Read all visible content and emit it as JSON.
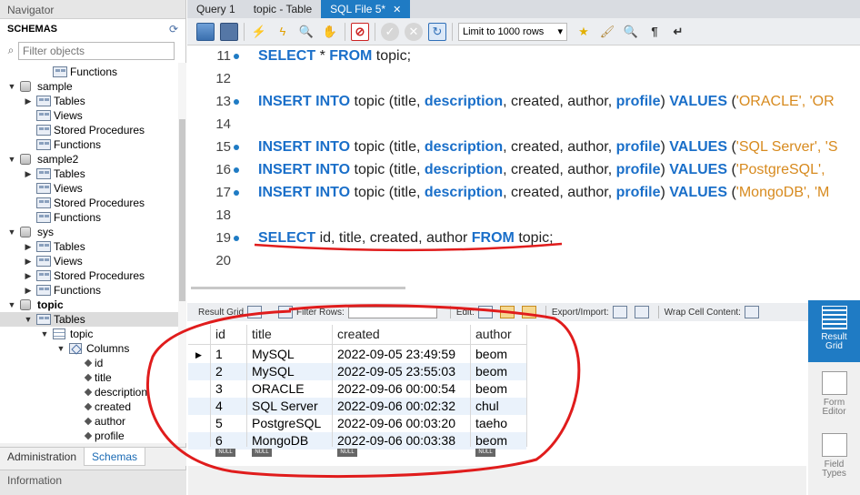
{
  "navigator": {
    "title": "Navigator",
    "schemas_label": "SCHEMAS",
    "filter_placeholder": "Filter objects",
    "tree": [
      {
        "indent": 0,
        "twisty": "",
        "icon": "folder",
        "label": "Functions",
        "depth": 2
      },
      {
        "indent": 0,
        "twisty": "▼",
        "icon": "db",
        "label": "sample",
        "depth": 0
      },
      {
        "indent": 1,
        "twisty": "▶",
        "icon": "folder",
        "label": "Tables",
        "depth": 1
      },
      {
        "indent": 1,
        "twisty": "",
        "icon": "folder",
        "label": "Views",
        "depth": 1
      },
      {
        "indent": 1,
        "twisty": "",
        "icon": "folder",
        "label": "Stored Procedures",
        "depth": 1
      },
      {
        "indent": 1,
        "twisty": "",
        "icon": "folder",
        "label": "Functions",
        "depth": 1
      },
      {
        "indent": 0,
        "twisty": "▼",
        "icon": "db",
        "label": "sample2",
        "depth": 0
      },
      {
        "indent": 1,
        "twisty": "▶",
        "icon": "folder",
        "label": "Tables",
        "depth": 1
      },
      {
        "indent": 1,
        "twisty": "",
        "icon": "folder",
        "label": "Views",
        "depth": 1
      },
      {
        "indent": 1,
        "twisty": "",
        "icon": "folder",
        "label": "Stored Procedures",
        "depth": 1
      },
      {
        "indent": 1,
        "twisty": "",
        "icon": "folder",
        "label": "Functions",
        "depth": 1
      },
      {
        "indent": 0,
        "twisty": "▼",
        "icon": "db",
        "label": "sys",
        "depth": 0
      },
      {
        "indent": 1,
        "twisty": "▶",
        "icon": "folder",
        "label": "Tables",
        "depth": 1
      },
      {
        "indent": 1,
        "twisty": "▶",
        "icon": "folder",
        "label": "Views",
        "depth": 1
      },
      {
        "indent": 1,
        "twisty": "▶",
        "icon": "folder",
        "label": "Stored Procedures",
        "depth": 1
      },
      {
        "indent": 1,
        "twisty": "▶",
        "icon": "folder",
        "label": "Functions",
        "depth": 1
      },
      {
        "indent": 0,
        "twisty": "▼",
        "icon": "db",
        "label": "topic",
        "depth": 0,
        "bold": true
      },
      {
        "indent": 1,
        "twisty": "▼",
        "icon": "folder",
        "label": "Tables",
        "depth": 1,
        "selected": true
      },
      {
        "indent": 2,
        "twisty": "▼",
        "icon": "table",
        "label": "topic",
        "depth": 2
      },
      {
        "indent": 3,
        "twisty": "▼",
        "icon": "col",
        "label": "Columns",
        "depth": 3
      },
      {
        "indent": 4,
        "twisty": "",
        "icon": "dot",
        "label": "id",
        "depth": 4
      },
      {
        "indent": 4,
        "twisty": "",
        "icon": "dot",
        "label": "title",
        "depth": 4
      },
      {
        "indent": 4,
        "twisty": "",
        "icon": "dot",
        "label": "description",
        "depth": 4
      },
      {
        "indent": 4,
        "twisty": "",
        "icon": "dot",
        "label": "created",
        "depth": 4
      },
      {
        "indent": 4,
        "twisty": "",
        "icon": "dot",
        "label": "author",
        "depth": 4
      },
      {
        "indent": 4,
        "twisty": "",
        "icon": "dot",
        "label": "profile",
        "depth": 4
      }
    ],
    "tabs": [
      {
        "label": "Administration",
        "active": false
      },
      {
        "label": "Schemas",
        "active": true
      }
    ],
    "info_label": "Information"
  },
  "tabs": [
    {
      "label": "Query 1",
      "active": false
    },
    {
      "label": "topic - Table",
      "active": false
    },
    {
      "label": "SQL File 5*",
      "active": true,
      "close": "✕"
    }
  ],
  "toolbar": {
    "limit_label": "Limit to 1000 rows"
  },
  "editor": {
    "lines": [
      {
        "num": "11",
        "bp": true,
        "tokens": [
          [
            "kw",
            "SELECT"
          ],
          [
            "pl",
            " * "
          ],
          [
            "kw",
            "FROM"
          ],
          [
            "pl",
            " topic;"
          ]
        ]
      },
      {
        "num": "12",
        "bp": false,
        "tokens": []
      },
      {
        "num": "13",
        "bp": true,
        "tokens": [
          [
            "kw",
            "INSERT INTO"
          ],
          [
            "pl",
            " topic (title, "
          ],
          [
            "kw",
            "description"
          ],
          [
            "pl",
            ", created, author, "
          ],
          [
            "kw",
            "profile"
          ],
          [
            "pl",
            ") "
          ],
          [
            "kw",
            "VALUES"
          ],
          [
            "pl",
            " ("
          ],
          [
            "str",
            "'ORACLE', 'OR"
          ]
        ]
      },
      {
        "num": "14",
        "bp": false,
        "tokens": []
      },
      {
        "num": "15",
        "bp": true,
        "tokens": [
          [
            "kw",
            "INSERT INTO"
          ],
          [
            "pl",
            " topic (title, "
          ],
          [
            "kw",
            "description"
          ],
          [
            "pl",
            ", created, author, "
          ],
          [
            "kw",
            "profile"
          ],
          [
            "pl",
            ") "
          ],
          [
            "kw",
            "VALUES"
          ],
          [
            "pl",
            " ("
          ],
          [
            "str",
            "'SQL Server', 'S"
          ]
        ]
      },
      {
        "num": "16",
        "bp": true,
        "tokens": [
          [
            "kw",
            "INSERT INTO"
          ],
          [
            "pl",
            " topic (title, "
          ],
          [
            "kw",
            "description"
          ],
          [
            "pl",
            ", created, author, "
          ],
          [
            "kw",
            "profile"
          ],
          [
            "pl",
            ") "
          ],
          [
            "kw",
            "VALUES"
          ],
          [
            "pl",
            " ("
          ],
          [
            "str",
            "'PostgreSQL', "
          ]
        ]
      },
      {
        "num": "17",
        "bp": true,
        "tokens": [
          [
            "kw",
            "INSERT INTO"
          ],
          [
            "pl",
            " topic (title, "
          ],
          [
            "kw",
            "description"
          ],
          [
            "pl",
            ", created, author, "
          ],
          [
            "kw",
            "profile"
          ],
          [
            "pl",
            ") "
          ],
          [
            "kw",
            "VALUES"
          ],
          [
            "pl",
            " ("
          ],
          [
            "str",
            "'MongoDB', 'M"
          ]
        ]
      },
      {
        "num": "18",
        "bp": false,
        "tokens": []
      },
      {
        "num": "19",
        "bp": true,
        "tokens": [
          [
            "kw",
            "SELECT"
          ],
          [
            "pl",
            " id, title, created, author "
          ],
          [
            "kw",
            "FROM"
          ],
          [
            "pl",
            " topic;"
          ]
        ]
      },
      {
        "num": "20",
        "bp": false,
        "tokens": []
      }
    ]
  },
  "result_toolbar": {
    "result_grid": "Result Grid",
    "filter_rows": "Filter Rows:",
    "edit": "Edit:",
    "export_import": "Export/Import:",
    "wrap": "Wrap Cell Content:"
  },
  "grid": {
    "columns": [
      "id",
      "title",
      "created",
      "author"
    ],
    "rows": [
      [
        "1",
        "MySQL",
        "2022-09-05 23:49:59",
        "beom"
      ],
      [
        "2",
        "MySQL",
        "2022-09-05 23:55:03",
        "beom"
      ],
      [
        "3",
        "ORACLE",
        "2022-09-06 00:00:54",
        "beom"
      ],
      [
        "4",
        "SQL Server",
        "2022-09-06 00:02:32",
        "chul"
      ],
      [
        "5",
        "PostgreSQL",
        "2022-09-06 00:03:20",
        "taeho"
      ],
      [
        "6",
        "MongoDB",
        "2022-09-06 00:03:38",
        "beom"
      ]
    ],
    "null_label": "NULL"
  },
  "side_panel": [
    {
      "label1": "Result",
      "label2": "Grid",
      "active": true
    },
    {
      "label1": "Form",
      "label2": "Editor",
      "active": false
    },
    {
      "label1": "Field",
      "label2": "Types",
      "active": false
    }
  ],
  "colors": {
    "accent": "#1f7bc4",
    "keyword": "#1a6fc9",
    "string": "#d78a1e",
    "annotation": "#e01c1c"
  }
}
